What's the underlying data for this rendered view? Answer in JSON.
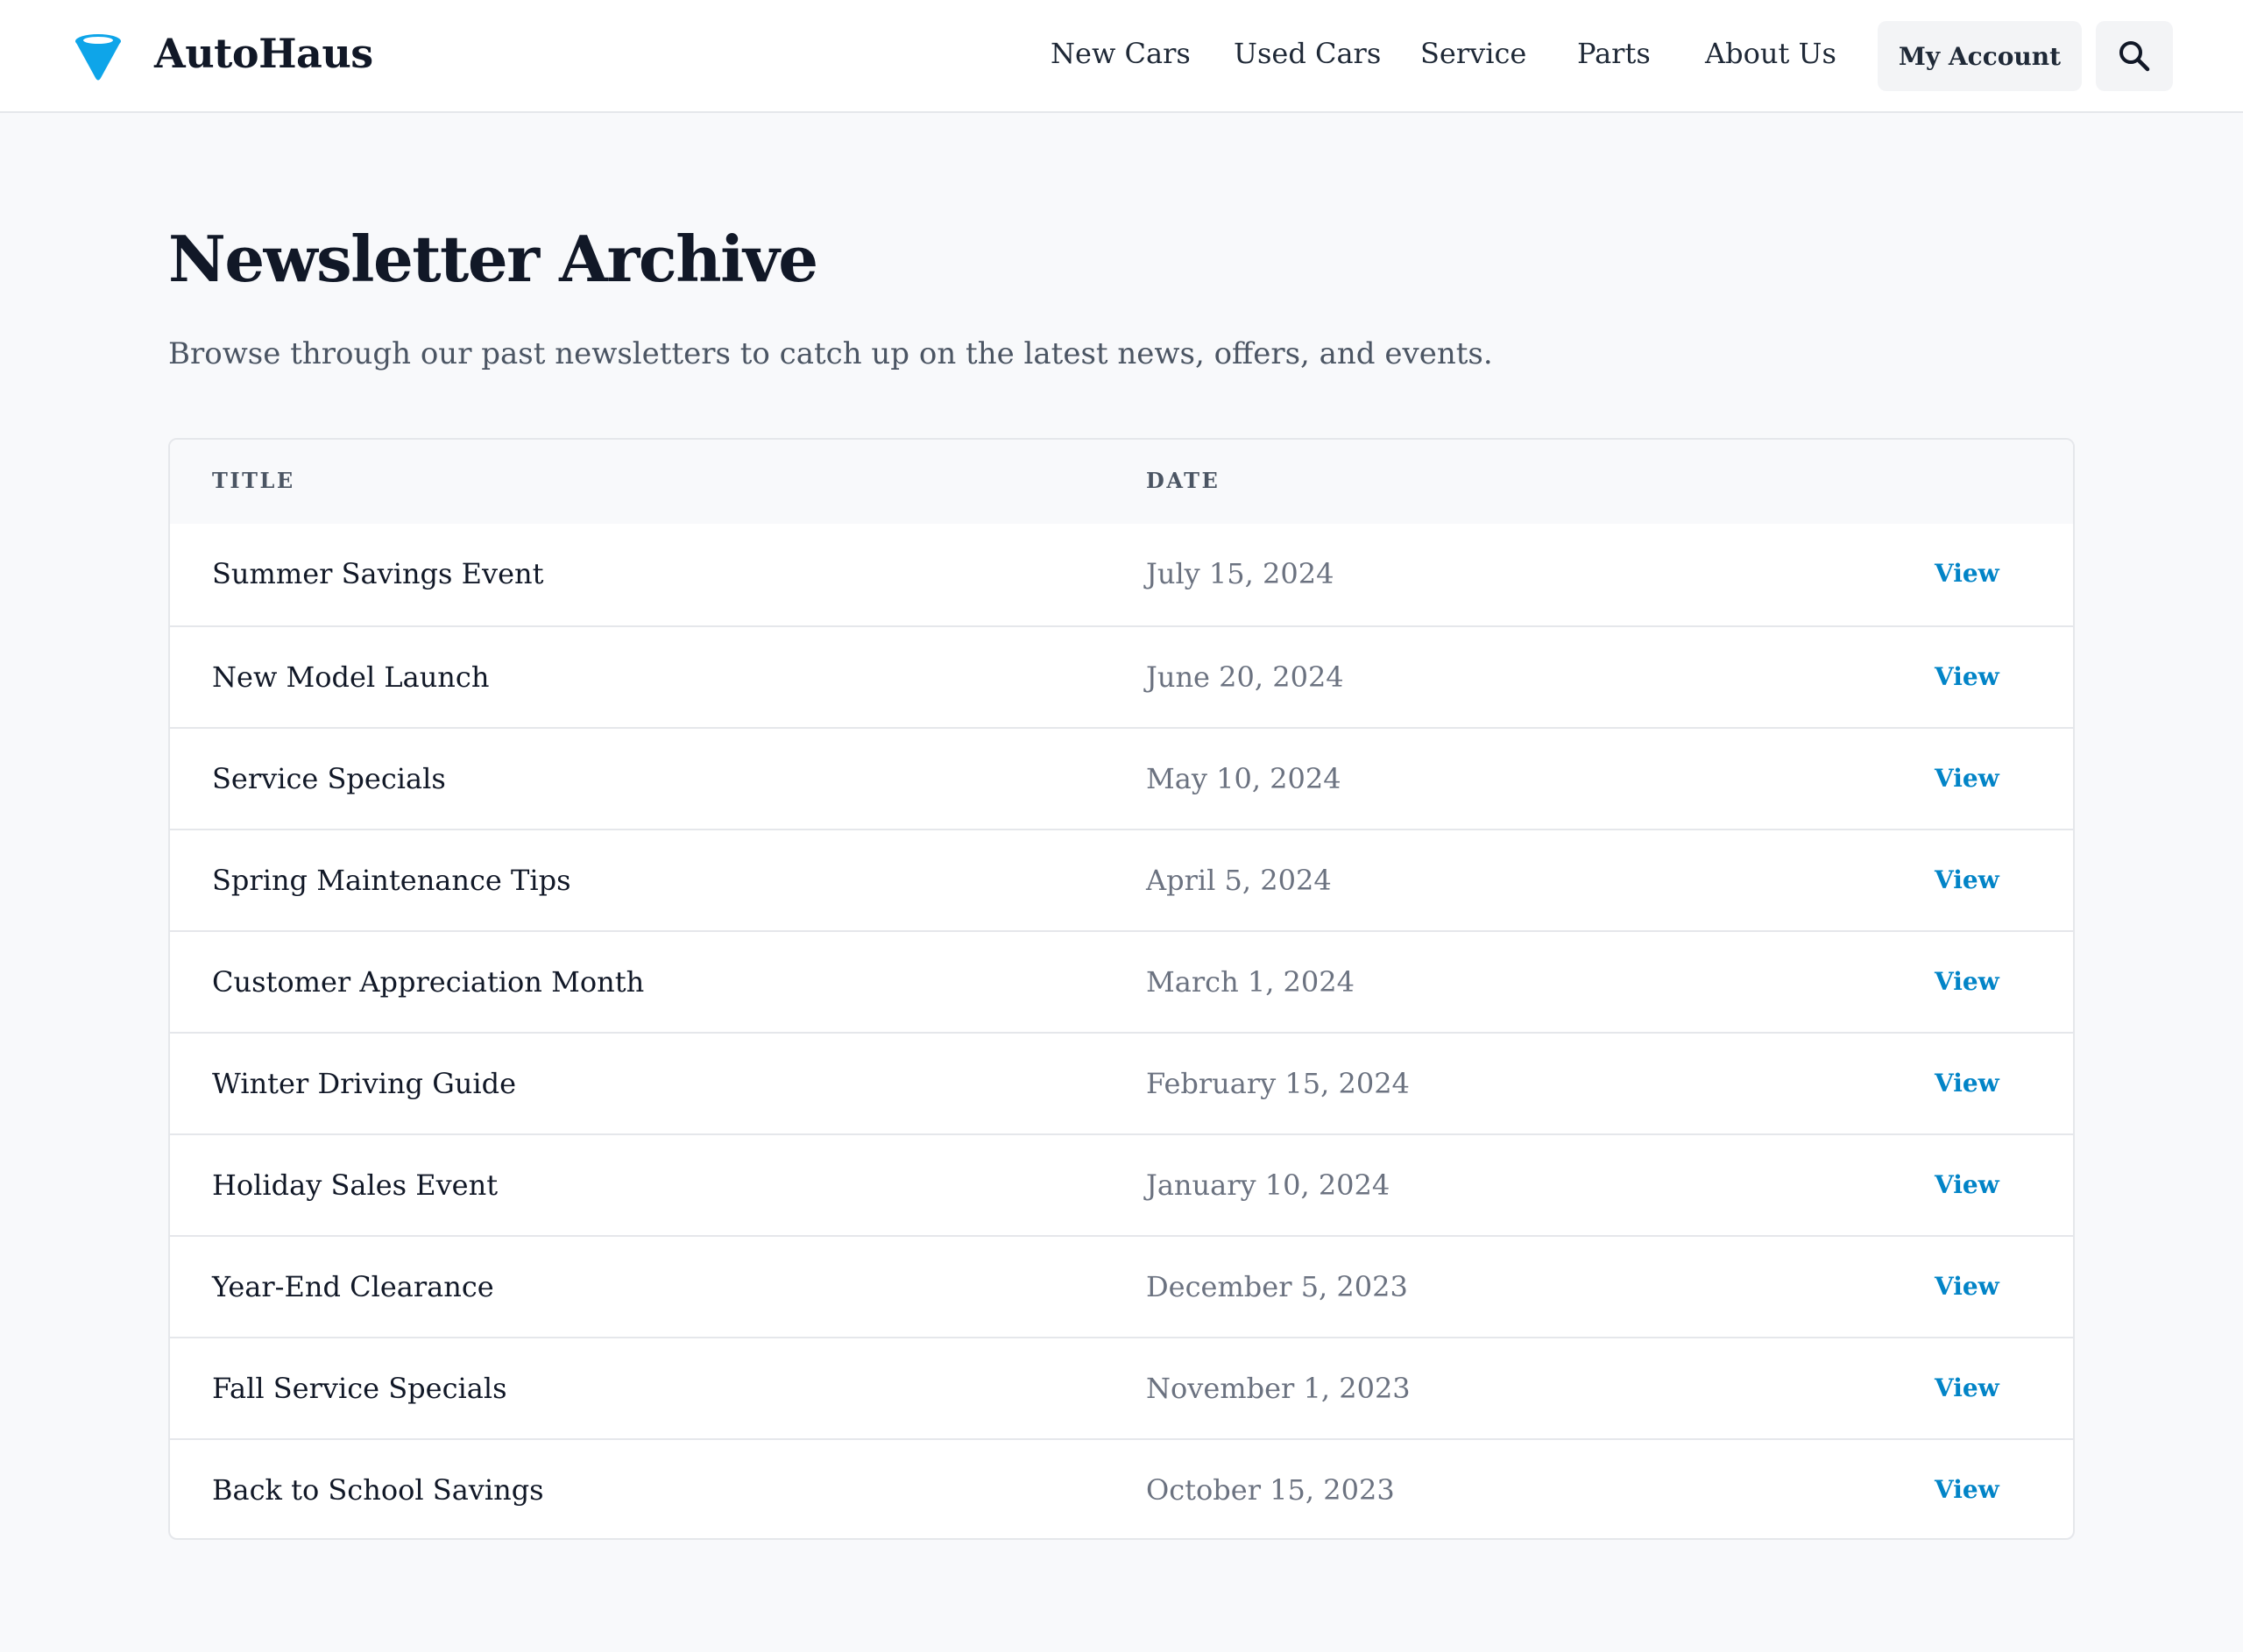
{
  "header": {
    "brand": "AutoHaus",
    "nav": [
      "New Cars",
      "Used Cars",
      "Service",
      "Parts",
      "About Us"
    ],
    "account_label": "My Account",
    "logo_icon": "blue-cone-logo-icon",
    "search_icon": "magnifier-search-icon"
  },
  "main": {
    "title": "Newsletter Archive",
    "subtitle": "Browse through our past newsletters to catch up on the latest news, offers, and events.",
    "table": {
      "headers": {
        "title": "TITLE",
        "date": "DATE"
      },
      "rows": [
        {
          "title": "Summer Savings Event",
          "date": "July 15, 2024",
          "action": "View"
        },
        {
          "title": "New Model Launch",
          "date": "June 20, 2024",
          "action": "View"
        },
        {
          "title": "Service Specials",
          "date": "May 10, 2024",
          "action": "View"
        },
        {
          "title": "Spring Maintenance Tips",
          "date": "April 5, 2024",
          "action": "View"
        },
        {
          "title": "Customer Appreciation Month",
          "date": "March 1, 2024",
          "action": "View"
        },
        {
          "title": "Winter Driving Guide",
          "date": "February 15, 2024",
          "action": "View"
        },
        {
          "title": "Holiday Sales Event",
          "date": "January 10, 2024",
          "action": "View"
        },
        {
          "title": "Year-End Clearance",
          "date": "December 5, 2023",
          "action": "View"
        },
        {
          "title": "Fall Service Specials",
          "date": "November 1, 2023",
          "action": "View"
        },
        {
          "title": "Back to School Savings",
          "date": "October 15, 2023",
          "action": "View"
        }
      ]
    }
  },
  "colors": {
    "accent": "#0284c7",
    "logo": "#0ea5e9",
    "page_background": "#f8f9fb",
    "border": "#e5e7eb"
  }
}
